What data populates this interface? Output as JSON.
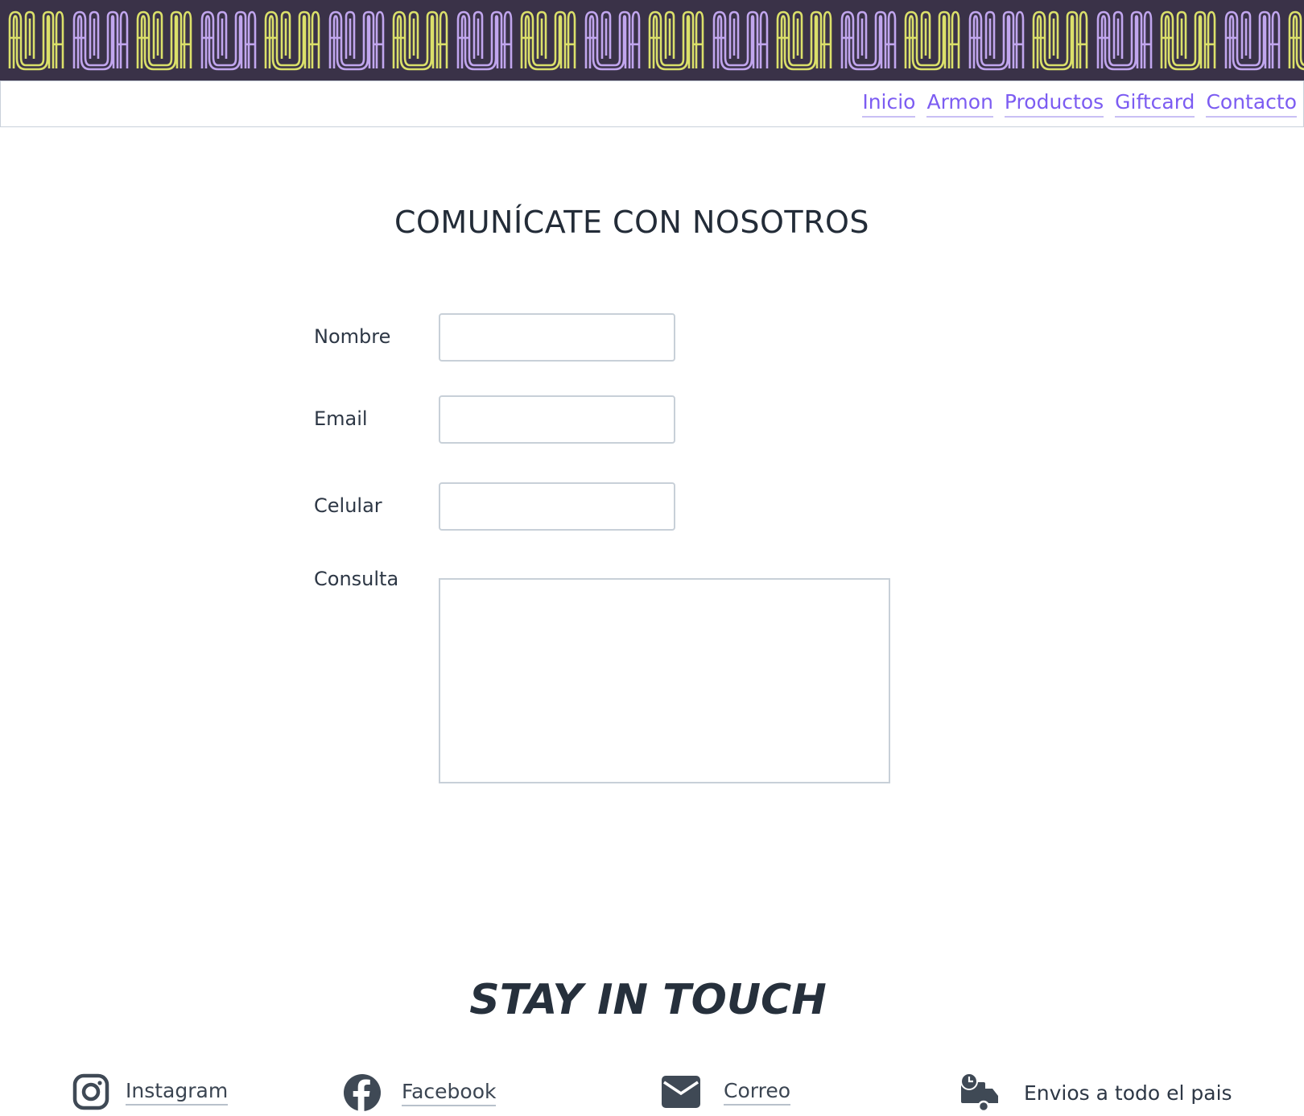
{
  "banner": {
    "logo_text": "ARMON",
    "tile_count": 21,
    "colors": {
      "background": "#3a3248",
      "yellow": "#dbe06a",
      "lilac": "#c1a6ee"
    }
  },
  "nav": {
    "items": [
      {
        "label": "Inicio"
      },
      {
        "label": "Armon"
      },
      {
        "label": "Productos"
      },
      {
        "label": "Giftcard"
      },
      {
        "label": "Contacto"
      }
    ],
    "link_color": "#7c5cf2"
  },
  "page": {
    "title": "COMUNÍCATE CON NOSOTROS"
  },
  "form": {
    "nombre_label": "Nombre",
    "nombre_value": "",
    "email_label": "Email",
    "email_value": "",
    "celular_label": "Celular",
    "celular_value": "",
    "consulta_label": "Consulta",
    "consulta_value": ""
  },
  "footer": {
    "title": "STAY IN TOUCH",
    "instagram": {
      "label": "Instagram",
      "icon": "instagram-icon"
    },
    "facebook": {
      "label": "Facebook",
      "icon": "facebook-icon"
    },
    "correo": {
      "label": "Correo",
      "icon": "envelope-icon"
    },
    "envios": {
      "label": "Envios a todo el pais",
      "icon": "delivery-truck-icon"
    }
  }
}
